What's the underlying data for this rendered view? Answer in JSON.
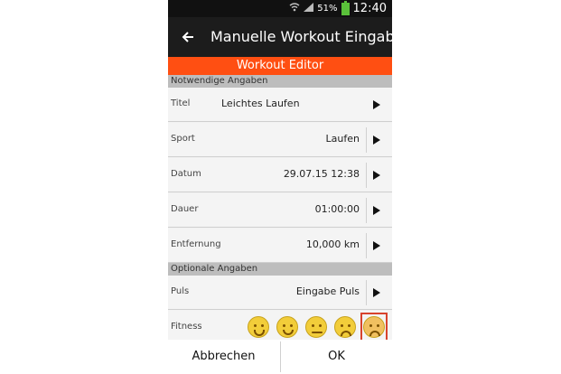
{
  "status_bar": {
    "battery_percent": "51%",
    "time": "12:40",
    "icons": [
      "wifi-icon",
      "signal-icon",
      "battery-icon"
    ]
  },
  "app_bar": {
    "title": "Manuelle Workout Eingabe",
    "back_icon": "back-arrow-icon"
  },
  "banner": {
    "title": "Workout Editor"
  },
  "sections": {
    "required": "Notwendige Angaben",
    "optional": "Optionale Angaben"
  },
  "rows": {
    "titel": {
      "label": "Titel",
      "value": "Leichtes Laufen"
    },
    "sport": {
      "label": "Sport",
      "value": "Laufen"
    },
    "datum": {
      "label": "Datum",
      "value": "29.07.15 12:38"
    },
    "dauer": {
      "label": "Dauer",
      "value": "01:00:00"
    },
    "entfernung": {
      "label": "Entfernung",
      "value": "10,000 km"
    },
    "puls": {
      "label": "Puls",
      "value": "Eingabe Puls"
    },
    "fitness": {
      "label": "Fitness",
      "selected_index": 4,
      "faces": [
        "very-happy",
        "happy",
        "neutral",
        "unhappy",
        "sad"
      ]
    }
  },
  "footer": {
    "cancel_label": "Abbrechen",
    "ok_label": "OK"
  },
  "colors": {
    "banner": "#ff4f12",
    "app_bar": "#1c1c1c",
    "section": "#bdbdbd",
    "selection_border": "#d8432d"
  }
}
